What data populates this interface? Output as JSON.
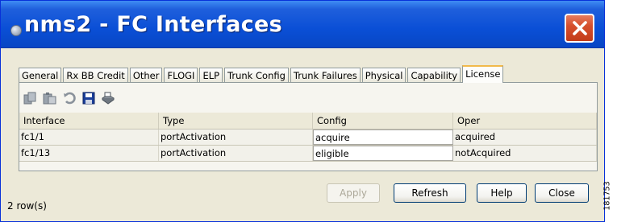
{
  "window": {
    "title": "nms2 - FC Interfaces",
    "close_icon": "close-icon"
  },
  "tabs": [
    {
      "label": "General",
      "active": false
    },
    {
      "label": "Rx BB Credit",
      "active": false
    },
    {
      "label": "Other",
      "active": false
    },
    {
      "label": "FLOGI",
      "active": false
    },
    {
      "label": "ELP",
      "active": false
    },
    {
      "label": "Trunk Config",
      "active": false
    },
    {
      "label": "Trunk Failures",
      "active": false
    },
    {
      "label": "Physical",
      "active": false
    },
    {
      "label": "Capability",
      "active": false
    },
    {
      "label": "License",
      "active": true
    }
  ],
  "toolbar": {
    "icons": [
      "copy-icon",
      "paste-icon",
      "undo-icon",
      "save-icon",
      "print-icon"
    ]
  },
  "table": {
    "columns": [
      "Interface",
      "Type",
      "Config",
      "Oper"
    ],
    "rows": [
      {
        "interface": "fc1/1",
        "type": "portActivation",
        "config": "acquire",
        "oper": "acquired"
      },
      {
        "interface": "fc1/13",
        "type": "portActivation",
        "config": "eligible",
        "oper": "notAcquired"
      }
    ]
  },
  "buttons": {
    "apply": "Apply",
    "refresh": "Refresh",
    "help": "Help",
    "close": "Close"
  },
  "status": {
    "row_count": "2 row(s)"
  },
  "figure_id": "181753",
  "colors": {
    "title_bar": "#0a4fd6",
    "close_button": "#d6502e",
    "active_tab_highlight": "#f1b94a",
    "dialog_bg": "#ece9d8"
  }
}
